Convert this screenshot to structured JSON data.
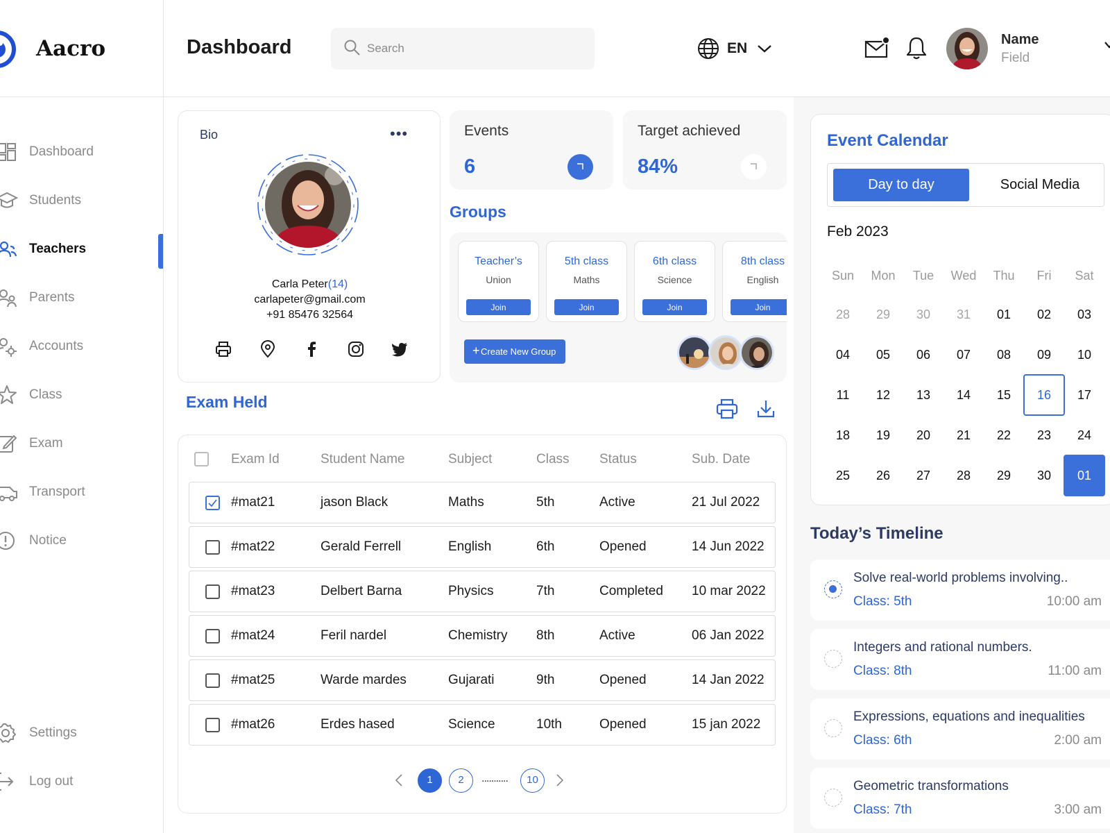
{
  "brand": {
    "name": "Aacro"
  },
  "sidebar": {
    "items": [
      {
        "label": "Dashboard",
        "icon": "dashboard-icon"
      },
      {
        "label": "Students",
        "icon": "graduation-cap-icon"
      },
      {
        "label": "Teachers",
        "icon": "users-icon",
        "active": true
      },
      {
        "label": "Parents",
        "icon": "parents-icon"
      },
      {
        "label": "Accounts",
        "icon": "account-settings-icon"
      },
      {
        "label": "Class",
        "icon": "star-icon"
      },
      {
        "label": "Exam",
        "icon": "edit-icon"
      },
      {
        "label": "Transport",
        "icon": "bus-icon"
      },
      {
        "label": "Notice",
        "icon": "alert-icon"
      }
    ],
    "bottom": [
      {
        "label": "Settings",
        "icon": "gear-icon"
      },
      {
        "label": "Log out",
        "icon": "logout-icon"
      }
    ]
  },
  "header": {
    "title": "Dashboard",
    "search_placeholder": "Search",
    "language": "EN",
    "user_name": "Name",
    "user_field": "Field"
  },
  "bio": {
    "title": "Bio",
    "more": "•••",
    "name": "Carla Peter",
    "age": "(14)",
    "email": "carlapeter@gmail.com",
    "phone": "+91 85476 32564"
  },
  "stats": [
    {
      "title": "Events",
      "value": "6"
    },
    {
      "title": "Target achieved",
      "value": "84%"
    }
  ],
  "groups": {
    "title": "Groups",
    "items": [
      {
        "name": "Teacher’s",
        "sub": "Union",
        "join": "Join"
      },
      {
        "name": "5th class",
        "sub": "Maths",
        "join": "Join"
      },
      {
        "name": "6th class",
        "sub": "Science",
        "join": "Join"
      },
      {
        "name": "8th class",
        "sub": "English",
        "join": "Join"
      }
    ],
    "create_label": "Create New Group"
  },
  "exams": {
    "title": "Exam Held",
    "columns": [
      "Exam Id",
      "Student Name",
      "Subject",
      "Class",
      "Status",
      "Sub. Date"
    ],
    "rows": [
      {
        "id": "#mat21",
        "name": "jason Black",
        "subject": "Maths",
        "class": "5th",
        "status": "Active",
        "date": "21 Jul 2022",
        "checked": true
      },
      {
        "id": "#mat22",
        "name": "Gerald Ferrell",
        "subject": "English",
        "class": "6th",
        "status": "Opened",
        "date": "14 Jun 2022",
        "checked": false
      },
      {
        "id": "#mat23",
        "name": "Delbert Barna",
        "subject": "Physics",
        "class": "7th",
        "status": "Completed",
        "date": "10 mar 2022",
        "checked": false
      },
      {
        "id": "#mat24",
        "name": "Feril nardel",
        "subject": "Chemistry",
        "class": "8th",
        "status": "Active",
        "date": "06 Jan 2022",
        "checked": false
      },
      {
        "id": "#mat25",
        "name": "Warde mardes",
        "subject": "Gujarati",
        "class": "9th",
        "status": "Opened",
        "date": "14 Jan 2022",
        "checked": false
      },
      {
        "id": "#mat26",
        "name": "Erdes hased",
        "subject": "Science",
        "class": "10th",
        "status": "Opened",
        "date": "15 jan 2022",
        "checked": false
      }
    ],
    "pagination": {
      "pages": [
        "1",
        "2",
        "10"
      ],
      "current": "1",
      "ellipsis": "..........."
    }
  },
  "calendar": {
    "title": "Event Calendar",
    "tabs": [
      "Day to day",
      "Social Media"
    ],
    "month": "Feb 2023",
    "weekdays": [
      "Sun",
      "Mon",
      "Tue",
      "Wed",
      "Thu",
      "Fri",
      "Sat"
    ],
    "weeks": [
      [
        "28",
        "29",
        "30",
        "31",
        "01",
        "02",
        "03"
      ],
      [
        "04",
        "05",
        "06",
        "07",
        "08",
        "09",
        "10"
      ],
      [
        "11",
        "12",
        "13",
        "14",
        "15",
        "16",
        "17"
      ],
      [
        "18",
        "19",
        "20",
        "21",
        "22",
        "23",
        "24"
      ],
      [
        "25",
        "26",
        "27",
        "28",
        "29",
        "30",
        "01"
      ]
    ],
    "today": "16",
    "selected": "01"
  },
  "timeline": {
    "title": "Today’s Timeline",
    "items": [
      {
        "text": "Solve real-world problems involving..",
        "class": "Class: 5th",
        "time": "10:00 am",
        "done": true
      },
      {
        "text": "Integers and rational numbers.",
        "class": "Class: 8th",
        "time": "11:00 am",
        "done": false
      },
      {
        "text": "Expressions, equations and inequalities",
        "class": "Class: 6th",
        "time": "2:00 am",
        "done": false
      },
      {
        "text": "Geometric transformations",
        "class": "Class: 7th",
        "time": "3:00 am",
        "done": false
      }
    ]
  },
  "colors": {
    "accent": "#3b6fd9",
    "accent_text": "#2f66d6",
    "heading_dark": "#2d3a64",
    "panel_bg": "#f7f7f7"
  }
}
